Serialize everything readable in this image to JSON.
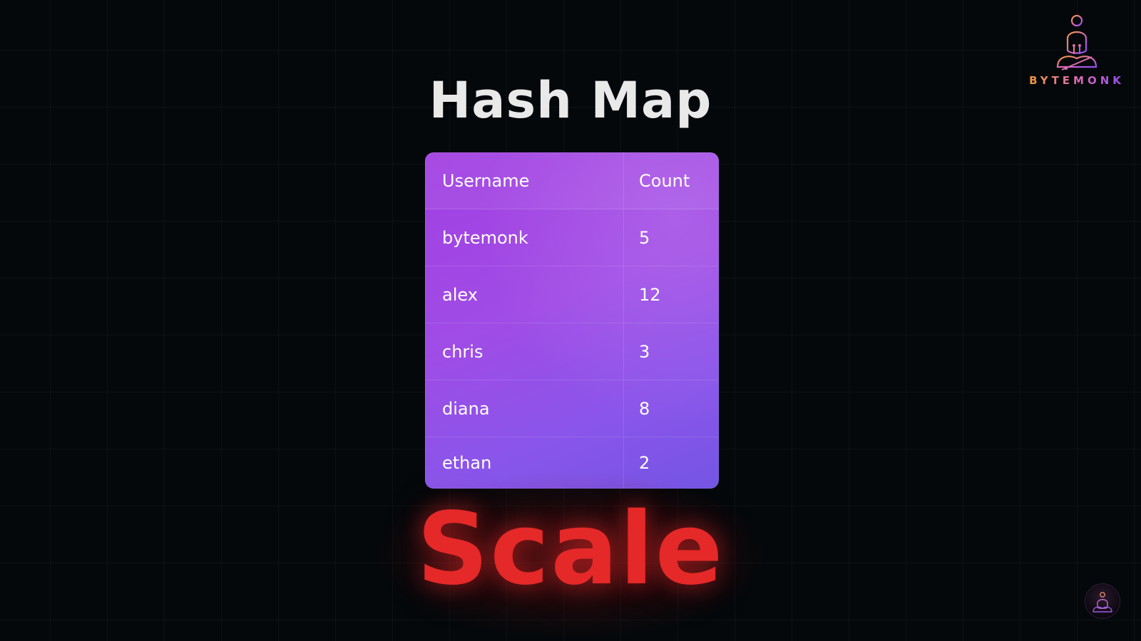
{
  "title": "Hash Map",
  "table": {
    "headers": [
      "Username",
      "Count"
    ],
    "rows": [
      {
        "username": "bytemonk",
        "count": "5"
      },
      {
        "username": "alex",
        "count": "12"
      },
      {
        "username": "chris",
        "count": "3"
      },
      {
        "username": "diana",
        "count": "8"
      },
      {
        "username": "ethan",
        "count": "2"
      }
    ]
  },
  "highlight_word": "Scale",
  "brand": {
    "name": "BYTEMONK",
    "icon": "meditating-monk-logo-icon"
  },
  "corner_badge_icon": "monk-badge-icon",
  "colors": {
    "background": "#04080b",
    "table_gradient_start": "#a23fe2",
    "table_gradient_end": "#7455e4",
    "highlight_red": "#e52828",
    "title_text": "#e9e9e9"
  }
}
